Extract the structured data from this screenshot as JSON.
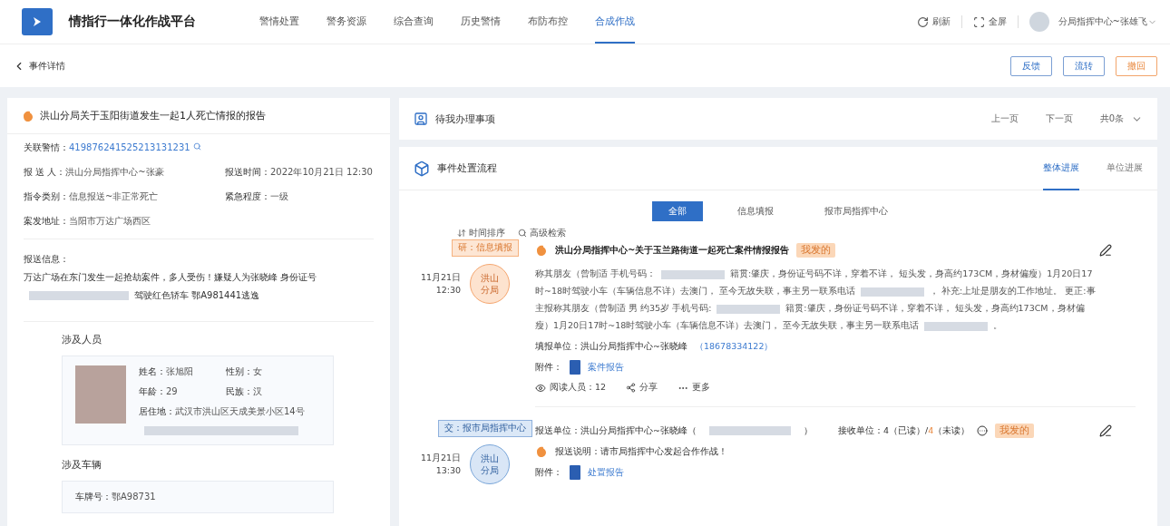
{
  "header": {
    "title": "情指行一体化作战平台",
    "nav": [
      {
        "label": "警情处置",
        "selected": false
      },
      {
        "label": "警务资源",
        "selected": false
      },
      {
        "label": "综合查询",
        "selected": false
      },
      {
        "label": "历史警情",
        "selected": false
      },
      {
        "label": "布防布控",
        "selected": false
      },
      {
        "label": "合成作战",
        "selected": true
      }
    ],
    "refresh": "刷新",
    "fullscreen": "全屏",
    "user": "分局指挥中心~张雄飞"
  },
  "subbar": {
    "back": "事件详情",
    "buttons": [
      {
        "label": "反馈",
        "kind": "normal"
      },
      {
        "label": "流转",
        "kind": "normal"
      },
      {
        "label": "撤回",
        "kind": "warning"
      }
    ]
  },
  "report": {
    "title": "洪山分局关于玉阳街道发生一起1人死亡情报的报告",
    "linked_alert": {
      "label": "关联警情：",
      "value": "419876241525213131231"
    },
    "rows": [
      [
        {
          "label": "报  送  人：",
          "value": "洪山分局指挥中心~张豪"
        },
        {
          "label": "报送时间：",
          "value": "2022年10月21日  12:30"
        }
      ],
      [
        {
          "label": "指令类别：",
          "value": "信息报送~非正常死亡"
        },
        {
          "label": "紧急程度：",
          "value": "一级"
        }
      ],
      [
        {
          "label": "案发地址：",
          "value": "当阳市万达广场西区"
        }
      ]
    ],
    "info_label": "报送信息：",
    "info_parts": [
      {
        "kind": "text",
        "text": "万达广场在东门发生一起抢劫案件，多人受伤！嫌疑人为张晓峰 身份证号"
      },
      {
        "kind": "redacted"
      },
      {
        "kind": "text",
        "text": "驾驶红色轿车 鄂A981441逃逸"
      }
    ],
    "persons_title": "涉及人员",
    "person": {
      "fields": [
        {
          "label": "姓名：",
          "value": "张旭阳"
        },
        {
          "label": "性别：",
          "value": "女"
        },
        {
          "label": "年龄：",
          "value": "29"
        },
        {
          "label": "民族：",
          "value": "汉"
        }
      ],
      "address": {
        "label": "居住地：",
        "value": "武汉市洪山区天成美景小区14号"
      }
    },
    "vehicles_title": "涉及车辆",
    "vehicle": {
      "label": "车牌号：",
      "value": "鄂A98731"
    }
  },
  "pending": {
    "title": "待我办理事项",
    "prev": "上一页",
    "next": "下一页",
    "count": "共0条"
  },
  "flow": {
    "title": "事件处置流程",
    "views": [
      {
        "label": "整体进展",
        "selected": true
      },
      {
        "label": "单位进展",
        "selected": false
      }
    ],
    "filters": [
      {
        "label": "全部",
        "selected": true
      },
      {
        "label": "信息填报",
        "selected": false
      },
      {
        "label": "报市局指挥中心",
        "selected": false
      }
    ],
    "sort": "时间排序",
    "search": "高级检索",
    "entries": [
      {
        "kind": "report",
        "tag": "研：信息填报",
        "date": "11月21日",
        "time": "12:30",
        "node": [
          "洪山",
          "分局"
        ],
        "title": "洪山分局指挥中心~关于玉兰路街道一起死亡案件情报报告",
        "badge": "我发的",
        "body": [
          {
            "kind": "text",
            "text": "称其朋友（曾制适  手机号码："
          },
          {
            "kind": "redacted"
          },
          {
            "kind": "text",
            "text": "籍贯:肇庆，身份证号码不详，穿着不详， 短头发，身高约173CM，身材偏瘦）1月20日17时~18时驾驶小车（车辆信息不详）去澳门，  至今无故失联，事主另一联系电话"
          },
          {
            "kind": "redacted"
          },
          {
            "kind": "text",
            "text": "， 补充:上址是朋友的工作地址。 更正:事主报称其朋友（曾制适  男  约35岁  手机号码:"
          },
          {
            "kind": "redacted"
          },
          {
            "kind": "text",
            "text": "籍贯:肇庆，身份证号码不详，穿着不详， 短头发，身高约173CM，身材偏瘦）1月20日17时~18时驾驶小车（车辆信息不详）去澳门，  至今无故失联，事主另一联系电话"
          },
          {
            "kind": "redacted"
          },
          {
            "kind": "text",
            "text": "。"
          }
        ],
        "filler_label": "填报单位：",
        "filler": "洪山分局指挥中心~张晓峰",
        "phone": "（18678334122）",
        "attach_label": "附件：",
        "attachment": "案件报告",
        "readers": "阅读人员：12",
        "share": "分享",
        "more": "更多"
      },
      {
        "kind": "dispatch",
        "tag": "交：报市局指挥中心",
        "date": "11月21日",
        "time": "13:30",
        "node": [
          "洪山",
          "分局"
        ],
        "sender": "报送单位：洪山分局指挥中心~张晓峰（",
        "sender_end": "）",
        "receiver": "接收单位：4（已读）/",
        "unread": "4",
        "unread_label": "（未读）",
        "badge": "我发的",
        "note": "报送说明：请市局指挥中心发起合作作战！",
        "attach_label": "附件：",
        "attachment": "处置报告"
      }
    ]
  }
}
